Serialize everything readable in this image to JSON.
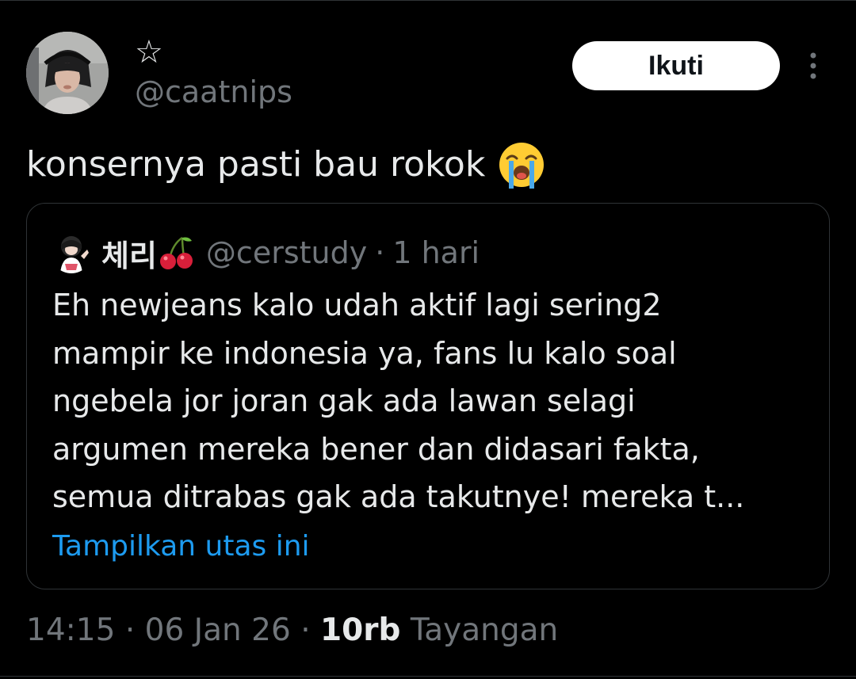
{
  "author": {
    "display_name": "☆",
    "handle": "@caatnips",
    "avatar_icon": "user-avatar-photo"
  },
  "actions": {
    "follow_label": "Ikuti",
    "more_icon": "more-vertical-icon"
  },
  "tweet": {
    "text": "konsernya pasti bau rokok",
    "emoji": "loudly-crying-face-emoji"
  },
  "quoted_tweet": {
    "display_name": "체리",
    "name_emoji": "cherry-emoji",
    "handle": "@cerstudy",
    "separator": "·",
    "time": "1 hari",
    "lines": [
      "Eh newjeans kalo udah aktif lagi sering2",
      "mampir ke indonesia ya, fans lu kalo soal",
      "ngebela jor joran gak ada lawan selagi",
      "argumen mereka bener dan didasari fakta,",
      "semua ditrabas gak ada takutnye! mereka t..."
    ],
    "show_thread_label": "Tampilkan utas ini"
  },
  "meta": {
    "time": "14:15",
    "sep1": "·",
    "date": "06 Jan 26",
    "sep2": "·",
    "views_count": "10rb",
    "views_label": "Tayangan"
  },
  "colors": {
    "background": "#000000",
    "text_primary": "#e7e9ea",
    "text_secondary": "#71767b",
    "link": "#1d9bf0",
    "border": "#2f3336",
    "button_bg": "#ffffff",
    "button_text": "#0f1419"
  }
}
